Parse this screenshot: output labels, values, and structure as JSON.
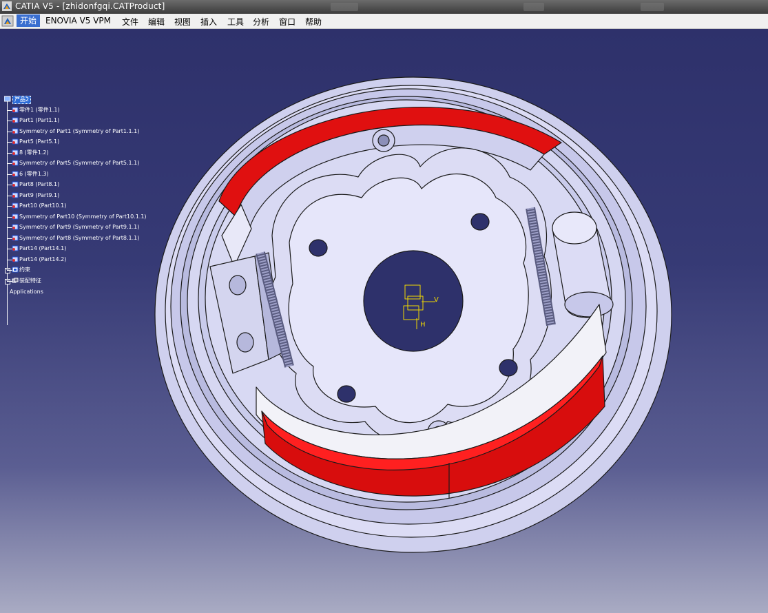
{
  "window": {
    "title": "CATIA V5 - [zhidonfgqi.CATProduct]"
  },
  "menu": {
    "items": [
      {
        "label": "开始",
        "active": true
      },
      {
        "label": "ENOVIA V5 VPM"
      },
      {
        "label": "文件"
      },
      {
        "label": "编辑"
      },
      {
        "label": "视图"
      },
      {
        "label": "插入"
      },
      {
        "label": "工具"
      },
      {
        "label": "分析"
      },
      {
        "label": "窗口"
      },
      {
        "label": "帮助"
      }
    ]
  },
  "spec_tree": {
    "root": "产品2",
    "items": [
      {
        "label": "零件1 (零件1.1)",
        "icon": "part-icon"
      },
      {
        "label": "Part1 (Part1.1)",
        "icon": "part-icon"
      },
      {
        "label": "Symmetry of Part1 (Symmetry of Part1.1.1)",
        "icon": "part-icon"
      },
      {
        "label": "Part5 (Part5.1)",
        "icon": "part-icon"
      },
      {
        "label": "8 (零件1.2)",
        "icon": "part-icon"
      },
      {
        "label": "Symmetry of Part5 (Symmetry of Part5.1.1)",
        "icon": "part-icon"
      },
      {
        "label": "6 (零件1.3)",
        "icon": "part-icon"
      },
      {
        "label": "Part8 (Part8.1)",
        "icon": "part-icon"
      },
      {
        "label": "Part9 (Part9.1)",
        "icon": "part-icon"
      },
      {
        "label": "Part10 (Part10.1)",
        "icon": "part-icon"
      },
      {
        "label": "Symmetry of Part10 (Symmetry of Part10.1.1)",
        "icon": "part-icon"
      },
      {
        "label": "Symmetry of Part9 (Symmetry of Part9.1.1)",
        "icon": "part-icon"
      },
      {
        "label": "Symmetry of Part8 (Symmetry of Part8.1.1)",
        "icon": "part-icon"
      },
      {
        "label": "Part14 (Part14.1)",
        "icon": "part-icon"
      },
      {
        "label": "Part14 (Part14.2)",
        "icon": "part-icon"
      },
      {
        "label": "约束",
        "icon": "constraints-icon"
      },
      {
        "label": "装配特征",
        "icon": "assembly-features-icon"
      }
    ],
    "applications": "Applications"
  },
  "compass": {
    "axis_v": "V",
    "axis_h": "H"
  },
  "colors": {
    "background_top": "#2e316b",
    "brake_lining": "#e01010",
    "part_face": "#d9daf1",
    "edge": "#1a1a1a",
    "selection": "#2d6bd6"
  }
}
